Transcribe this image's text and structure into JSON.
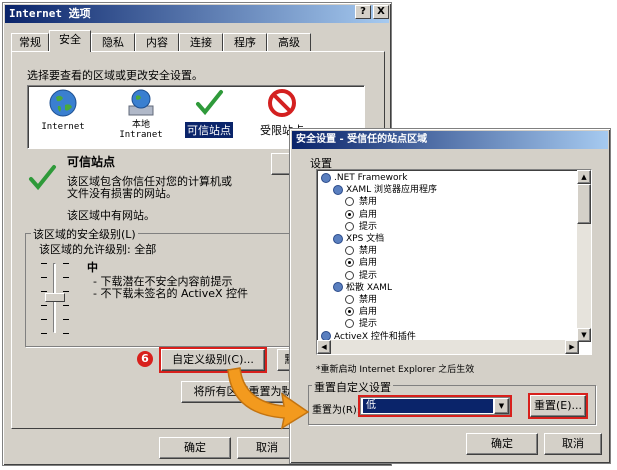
{
  "main_dialog": {
    "title": "Internet 选项",
    "help_btn": "?",
    "close_btn": "X",
    "tabs": [
      "常规",
      "安全",
      "隐私",
      "内容",
      "连接",
      "程序",
      "高级"
    ],
    "zone_prompt": "选择要查看的区域或更改安全设置。",
    "zones": [
      {
        "label": "Internet",
        "label2": ""
      },
      {
        "label": "本地",
        "label2": "Intranet"
      },
      {
        "label": "可信站点",
        "label2": ""
      },
      {
        "label": "受限站点",
        "label2": ""
      }
    ],
    "zone_title": "可信站点",
    "zone_desc1": "该区域包含你信任对您的计算机或",
    "zone_desc2": "文件没有损害的网站。",
    "zone_desc3": "该区域中有网站。",
    "level_group": "该区域的安全级别(L)",
    "allowed_level": "该区域的允许级别: 全部",
    "level_name": "中",
    "level_bullet1": "- 下载潜在不安全内容前提示",
    "level_bullet2": "- 不下载未签名的 ActiveX 控件",
    "step_number": "6",
    "custom_level_btn": "自定义级别(C)...",
    "default_level_btn": "默",
    "reset_all_btn": "将所有区域重置为默",
    "ok_btn": "确定",
    "cancel_btn": "取消"
  },
  "security_dialog": {
    "title": "安全设置 - 受信任的站点区域",
    "settings_label": "设置",
    "tree": [
      {
        "type": "group",
        "text": ".NET Framework",
        "level": 0
      },
      {
        "type": "group",
        "text": "XAML 浏览器应用程序",
        "level": 1
      },
      {
        "type": "radio",
        "text": "禁用",
        "level": 2,
        "on": false
      },
      {
        "type": "radio",
        "text": "启用",
        "level": 2,
        "on": true
      },
      {
        "type": "radio",
        "text": "提示",
        "level": 2,
        "on": false
      },
      {
        "type": "group",
        "text": "XPS 文档",
        "level": 1
      },
      {
        "type": "radio",
        "text": "禁用",
        "level": 2,
        "on": false
      },
      {
        "type": "radio",
        "text": "启用",
        "level": 2,
        "on": true
      },
      {
        "type": "radio",
        "text": "提示",
        "level": 2,
        "on": false
      },
      {
        "type": "group",
        "text": "松散 XAML",
        "level": 1
      },
      {
        "type": "radio",
        "text": "禁用",
        "level": 2,
        "on": false
      },
      {
        "type": "radio",
        "text": "启用",
        "level": 2,
        "on": true
      },
      {
        "type": "radio",
        "text": "提示",
        "level": 2,
        "on": false
      },
      {
        "type": "group",
        "text": "ActiveX 控件和插件",
        "level": 0
      }
    ],
    "restart_note": "*重新启动 Internet Explorer 之后生效",
    "reset_group": "重置自定义设置",
    "reset_to_label": "重置为(R):",
    "reset_to_value": "低",
    "reset_btn": "重置(E)...",
    "ok_btn": "确定",
    "cancel_btn": "取消"
  },
  "colors": {
    "accent_red": "#d8201c",
    "arrow_orange": "#f39a1e",
    "titlebar": "#0a246a"
  }
}
